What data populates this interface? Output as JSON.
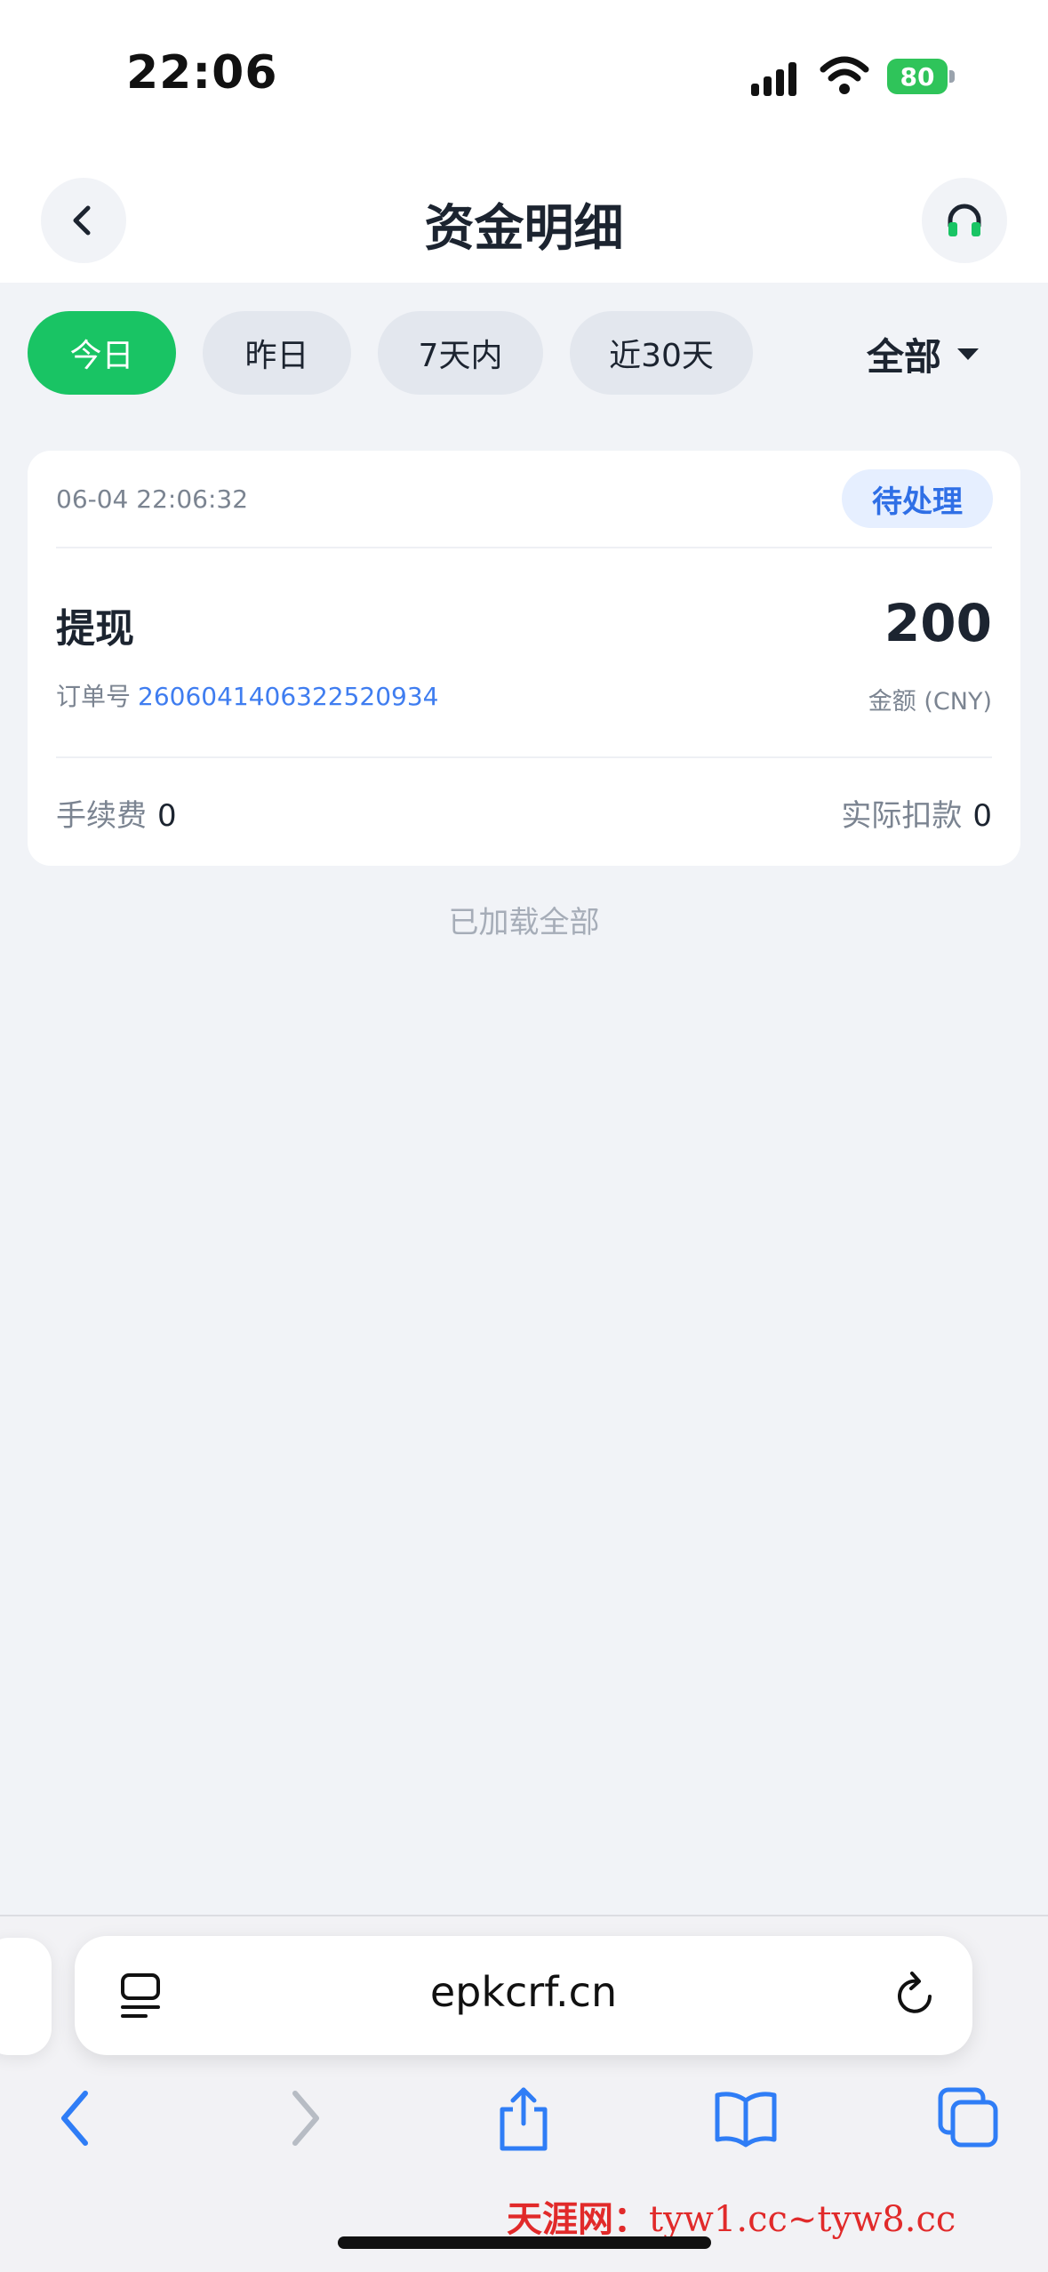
{
  "status_bar": {
    "time": "22:06",
    "battery": "80"
  },
  "header": {
    "title": "资金明细"
  },
  "filters": {
    "chips": [
      {
        "label": "今日",
        "active": true
      },
      {
        "label": "昨日",
        "active": false
      },
      {
        "label": "7天内",
        "active": false
      },
      {
        "label": "近30天",
        "active": false
      }
    ],
    "type_select": "全部"
  },
  "record": {
    "time": "06-04 22:06:32",
    "status": "待处理",
    "type": "提现",
    "amount": "200",
    "order_label": "订单号",
    "order_no": "2606041406322520934",
    "amount_label": "金额 (CNY)",
    "fee_label": "手续费",
    "fee_value": "0",
    "deduct_label": "实际扣款",
    "deduct_value": "0"
  },
  "list_footer": "已加载全部",
  "browser": {
    "url": "epkcrf.cn",
    "watermark_a": "天涯网：",
    "watermark_b": "tyw1.cc~tyw8.cc"
  },
  "colors": {
    "accent_green": "#19c464",
    "status_blue": "#2f6fe6",
    "background": "#f1f3f7"
  },
  "icons": [
    "back-icon",
    "headset-icon",
    "reader-icon",
    "reload-icon",
    "back-nav-icon",
    "forward-nav-icon",
    "share-icon",
    "bookmarks-icon",
    "tabs-icon"
  ]
}
